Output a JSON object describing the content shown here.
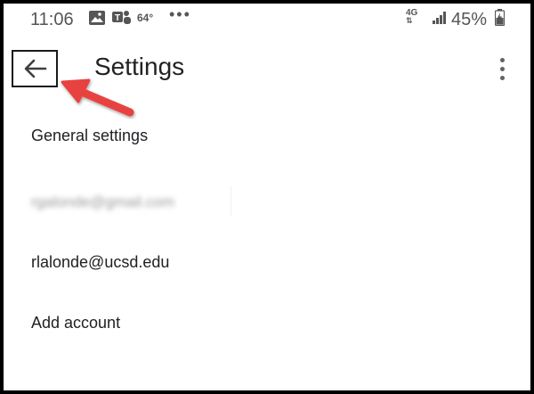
{
  "status_bar": {
    "time": "11:06",
    "temperature": "64°",
    "more": "•••",
    "network": "4G",
    "battery": "45%"
  },
  "app_bar": {
    "title": "Settings",
    "back_icon": "arrow-back-icon",
    "menu_icon": "more-vert-icon"
  },
  "annotation": {
    "arrow_color": "#e8423f"
  },
  "settings_list": {
    "general": "General settings",
    "account_blurred": "rgalonde@gmail.com",
    "account_ucsd": "rlalonde@ucsd.edu",
    "add_account": "Add account"
  }
}
